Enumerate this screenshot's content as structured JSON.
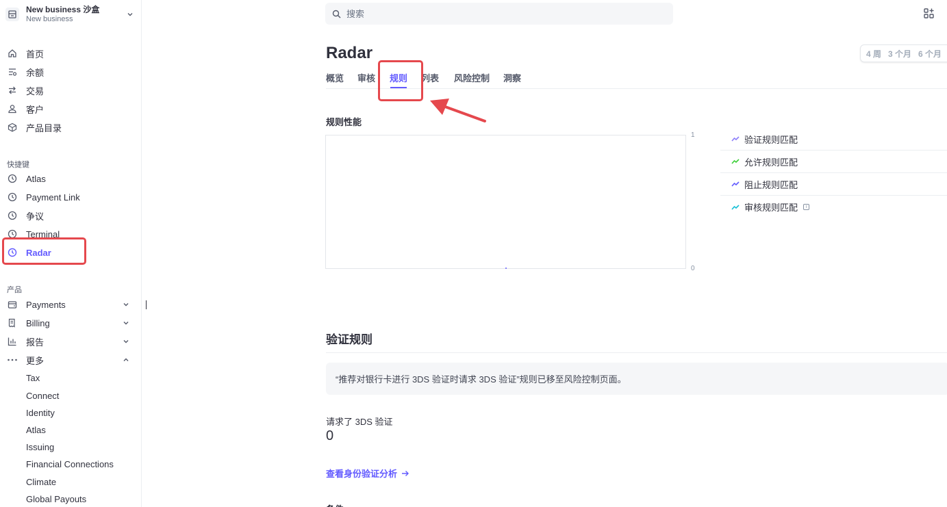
{
  "account": {
    "name": "New business 沙盒",
    "sub": "New business"
  },
  "nav": [
    {
      "label": "首页",
      "icon": "home-icon"
    },
    {
      "label": "余额",
      "icon": "balance-icon"
    },
    {
      "label": "交易",
      "icon": "transfer-icon"
    },
    {
      "label": "客户",
      "icon": "person-icon"
    },
    {
      "label": "产品目录",
      "icon": "box-icon"
    }
  ],
  "shortcuts": {
    "title": "快捷键",
    "items": [
      {
        "label": "Atlas"
      },
      {
        "label": "Payment Link"
      },
      {
        "label": "争议"
      },
      {
        "label": "Terminal"
      },
      {
        "label": "Radar"
      }
    ]
  },
  "products": {
    "title": "产品",
    "items": [
      {
        "label": "Payments"
      },
      {
        "label": "Billing"
      },
      {
        "label": "报告"
      },
      {
        "label": "更多"
      }
    ],
    "more_items": [
      "Tax",
      "Connect",
      "Identity",
      "Atlas",
      "Issuing",
      "Financial Connections",
      "Climate",
      "Global Payouts"
    ]
  },
  "search": {
    "placeholder": "搜索"
  },
  "page": {
    "title": "Radar",
    "range": [
      "4 周",
      "3 个月",
      "6 个月"
    ],
    "tabs": [
      "概览",
      "审核",
      "规则",
      "列表",
      "风险控制",
      "洞察"
    ],
    "active_tab": "规则"
  },
  "performance": {
    "title": "规则性能",
    "y_max": "1",
    "y_min": "0",
    "legend": [
      {
        "label": "验证规则匹配",
        "color": "#8d7ffa"
      },
      {
        "label": "允许规则匹配",
        "color": "#3ecf3a"
      },
      {
        "label": "阻止规则匹配",
        "color": "#635bff"
      },
      {
        "label": "审核规则匹配",
        "color": "#17c0d6"
      }
    ]
  },
  "verification": {
    "title": "验证规则",
    "notice": "“推荐对银行卡进行 3DS 验证时请求 3DS 验证”规则已移至风险控制页面。",
    "stat_label": "请求了 3DS 验证",
    "stat_value": "0",
    "link": "查看身份验证分析"
  },
  "cut_off": "条件"
}
